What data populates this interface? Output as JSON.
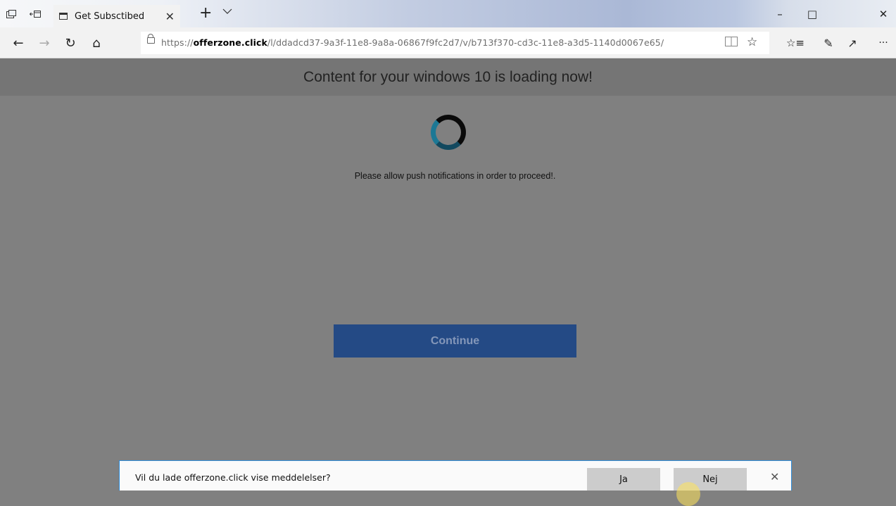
{
  "browser": {
    "tab": {
      "title": "Get Subsctibed"
    },
    "icons": {
      "tab_actions": "tab-actions-icon",
      "set_aside": "set-aside-tabs-icon",
      "new_tab": "+",
      "tab_menu": "chevron-down-icon"
    },
    "window_controls": {
      "minimize": "–",
      "maximize": "□",
      "close": "✕"
    },
    "nav": {
      "back": "←",
      "forward": "→",
      "refresh": "↻",
      "home": "⌂"
    },
    "address": {
      "url_prefix": "https://",
      "url_domain": "offerzone.click",
      "url_path": "/l/ddadcd37-9a3f-11e8-9a8a-06867f9fc2d7/v/b713f370-cd3c-11e8-a3d5-1140d0067e65/"
    },
    "toolbar_right": {
      "reading_view": "📖",
      "favorite": "☆",
      "favorites_hub": "☆≡",
      "notes": "✎",
      "share": "↗",
      "more": "···"
    }
  },
  "page": {
    "header": "Content for your windows 10 is loading now!",
    "notice": "Please allow push notifications in order to proceed!.",
    "continue_label": "Continue",
    "colors": {
      "header_bg": "#757575",
      "page_bg": "#808080",
      "button_bg": "#244a85"
    }
  },
  "prompt": {
    "message": "Vil du lade offerzone.click vise meddelelser?",
    "yes_label": "Ja",
    "no_label": "Nej",
    "close": "✕"
  }
}
